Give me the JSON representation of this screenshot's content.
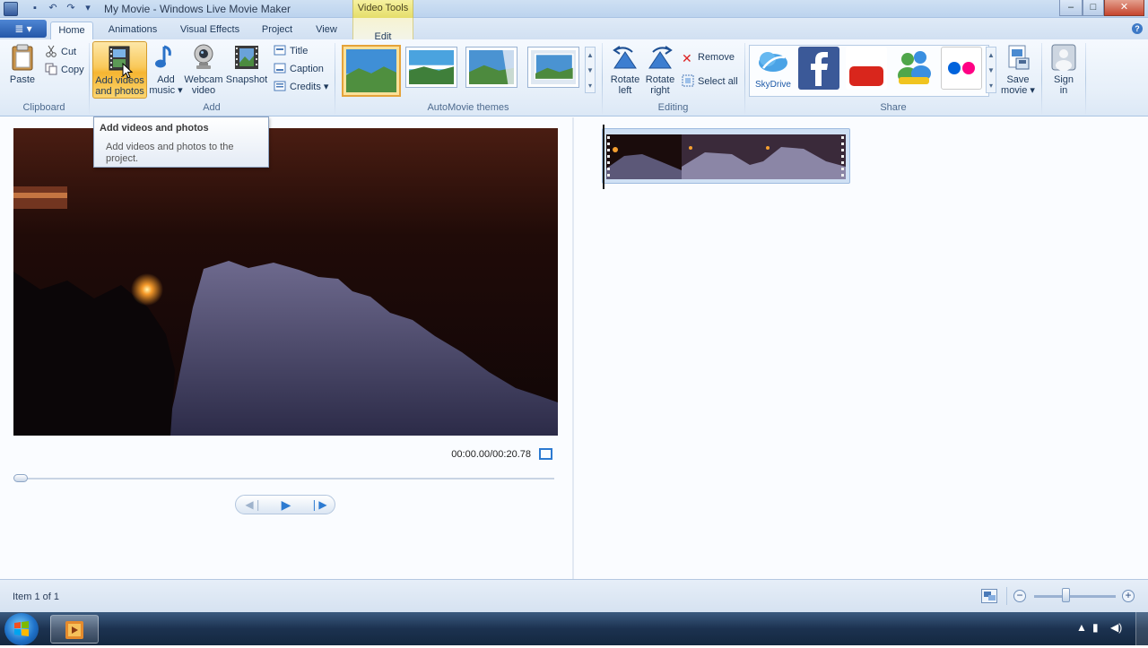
{
  "window": {
    "title": "My Movie - Windows Live Movie Maker",
    "contextual_header": "Video Tools",
    "minimize": "–",
    "maximize": "□",
    "close": "✕"
  },
  "quick_access": {
    "save": "▪",
    "undo": "↶",
    "redo": "↷",
    "more": "▾"
  },
  "tabs": {
    "app_menu": "≣ ▾",
    "home": "Home",
    "animations": "Animations",
    "visual_effects": "Visual Effects",
    "project": "Project",
    "view": "View",
    "edit": "Edit",
    "help": "?"
  },
  "ribbon": {
    "clipboard": {
      "label": "Clipboard",
      "paste": "Paste",
      "cut": "Cut",
      "copy": "Copy"
    },
    "add": {
      "label": "Add",
      "add_videos_line1": "Add videos",
      "add_videos_line2": "and photos",
      "add_music_line1": "Add",
      "add_music_line2": "music ▾",
      "webcam_line1": "Webcam",
      "webcam_line2": "video",
      "snapshot": "Snapshot",
      "title": "Title",
      "caption": "Caption",
      "credits": "Credits ▾"
    },
    "automovie": {
      "label": "AutoMovie themes"
    },
    "editing": {
      "label": "Editing",
      "rotate_left_1": "Rotate",
      "rotate_left_2": "left",
      "rotate_right_1": "Rotate",
      "rotate_right_2": "right",
      "remove": "Remove",
      "select_all": "Select all"
    },
    "share": {
      "label": "Share",
      "skydrive": "SkyDrive",
      "save_movie_1": "Save",
      "save_movie_2": "movie ▾",
      "sign_in_1": "Sign",
      "sign_in_2": "in"
    }
  },
  "tooltip": {
    "title": "Add videos and photos",
    "body": "Add videos and photos to the project."
  },
  "player": {
    "time": "00:00.00/00:20.78",
    "position_fraction": 0.0
  },
  "status": {
    "items": "Item 1 of 1",
    "zoom_fraction": 0.38
  },
  "colors": {
    "ribbon_bg": "#e6eff9",
    "accent_blue": "#2c7ad1",
    "highlight_orange": "#f6b532",
    "contextual_yellow": "#e5de6a"
  }
}
